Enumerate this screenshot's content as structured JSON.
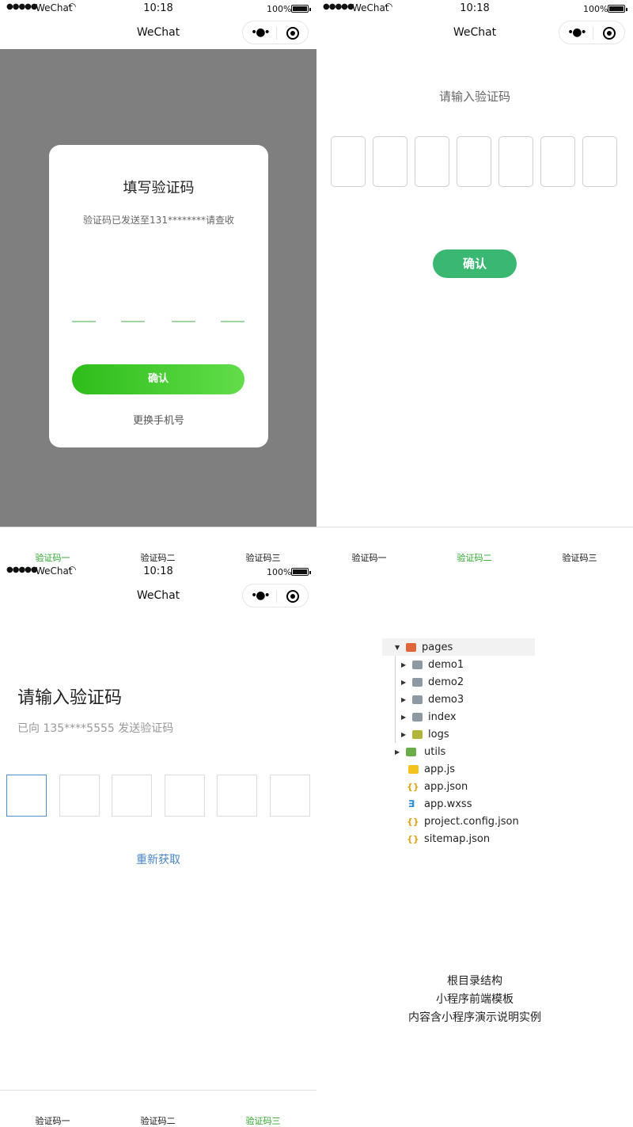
{
  "status": {
    "carrier": "WeChat",
    "time": "10:18",
    "battery": "100%"
  },
  "nav": {
    "title": "WeChat"
  },
  "screen1": {
    "title": "填写验证码",
    "subtitle": "验证码已发送至131********请查收",
    "confirm": "确认",
    "change_phone": "更换手机号"
  },
  "screen2": {
    "title": "请输入验证码",
    "confirm": "确认"
  },
  "screen3": {
    "title": "请输入验证码",
    "subtitle": "已向 135****5555 发送验证码",
    "resend": "重新获取"
  },
  "tabs": [
    "验证码一",
    "验证码二",
    "验证码三"
  ],
  "tree": [
    {
      "label": "pages",
      "icon": "folder-open-icon"
    },
    {
      "label": "demo1",
      "icon": "folder-icon"
    },
    {
      "label": "demo2",
      "icon": "folder-icon"
    },
    {
      "label": "demo3",
      "icon": "folder-icon"
    },
    {
      "label": "index",
      "icon": "folder-icon"
    },
    {
      "label": "logs",
      "icon": "folder-icon"
    },
    {
      "label": "utils",
      "icon": "folder-icon"
    },
    {
      "label": "app.js",
      "icon": "js-file-icon"
    },
    {
      "label": "app.json",
      "icon": "json-file-icon"
    },
    {
      "label": "app.wxss",
      "icon": "css-file-icon"
    },
    {
      "label": "project.config.json",
      "icon": "json-file-icon"
    },
    {
      "label": "sitemap.json",
      "icon": "json-file-icon"
    }
  ],
  "captions": [
    "根目录结构",
    "小程序前端模板",
    "内容含小程序演示说明实例"
  ],
  "colors": {
    "accent_green": "#2aa52a",
    "button_green": "#3ab872",
    "link_blue": "#4a86c8"
  }
}
